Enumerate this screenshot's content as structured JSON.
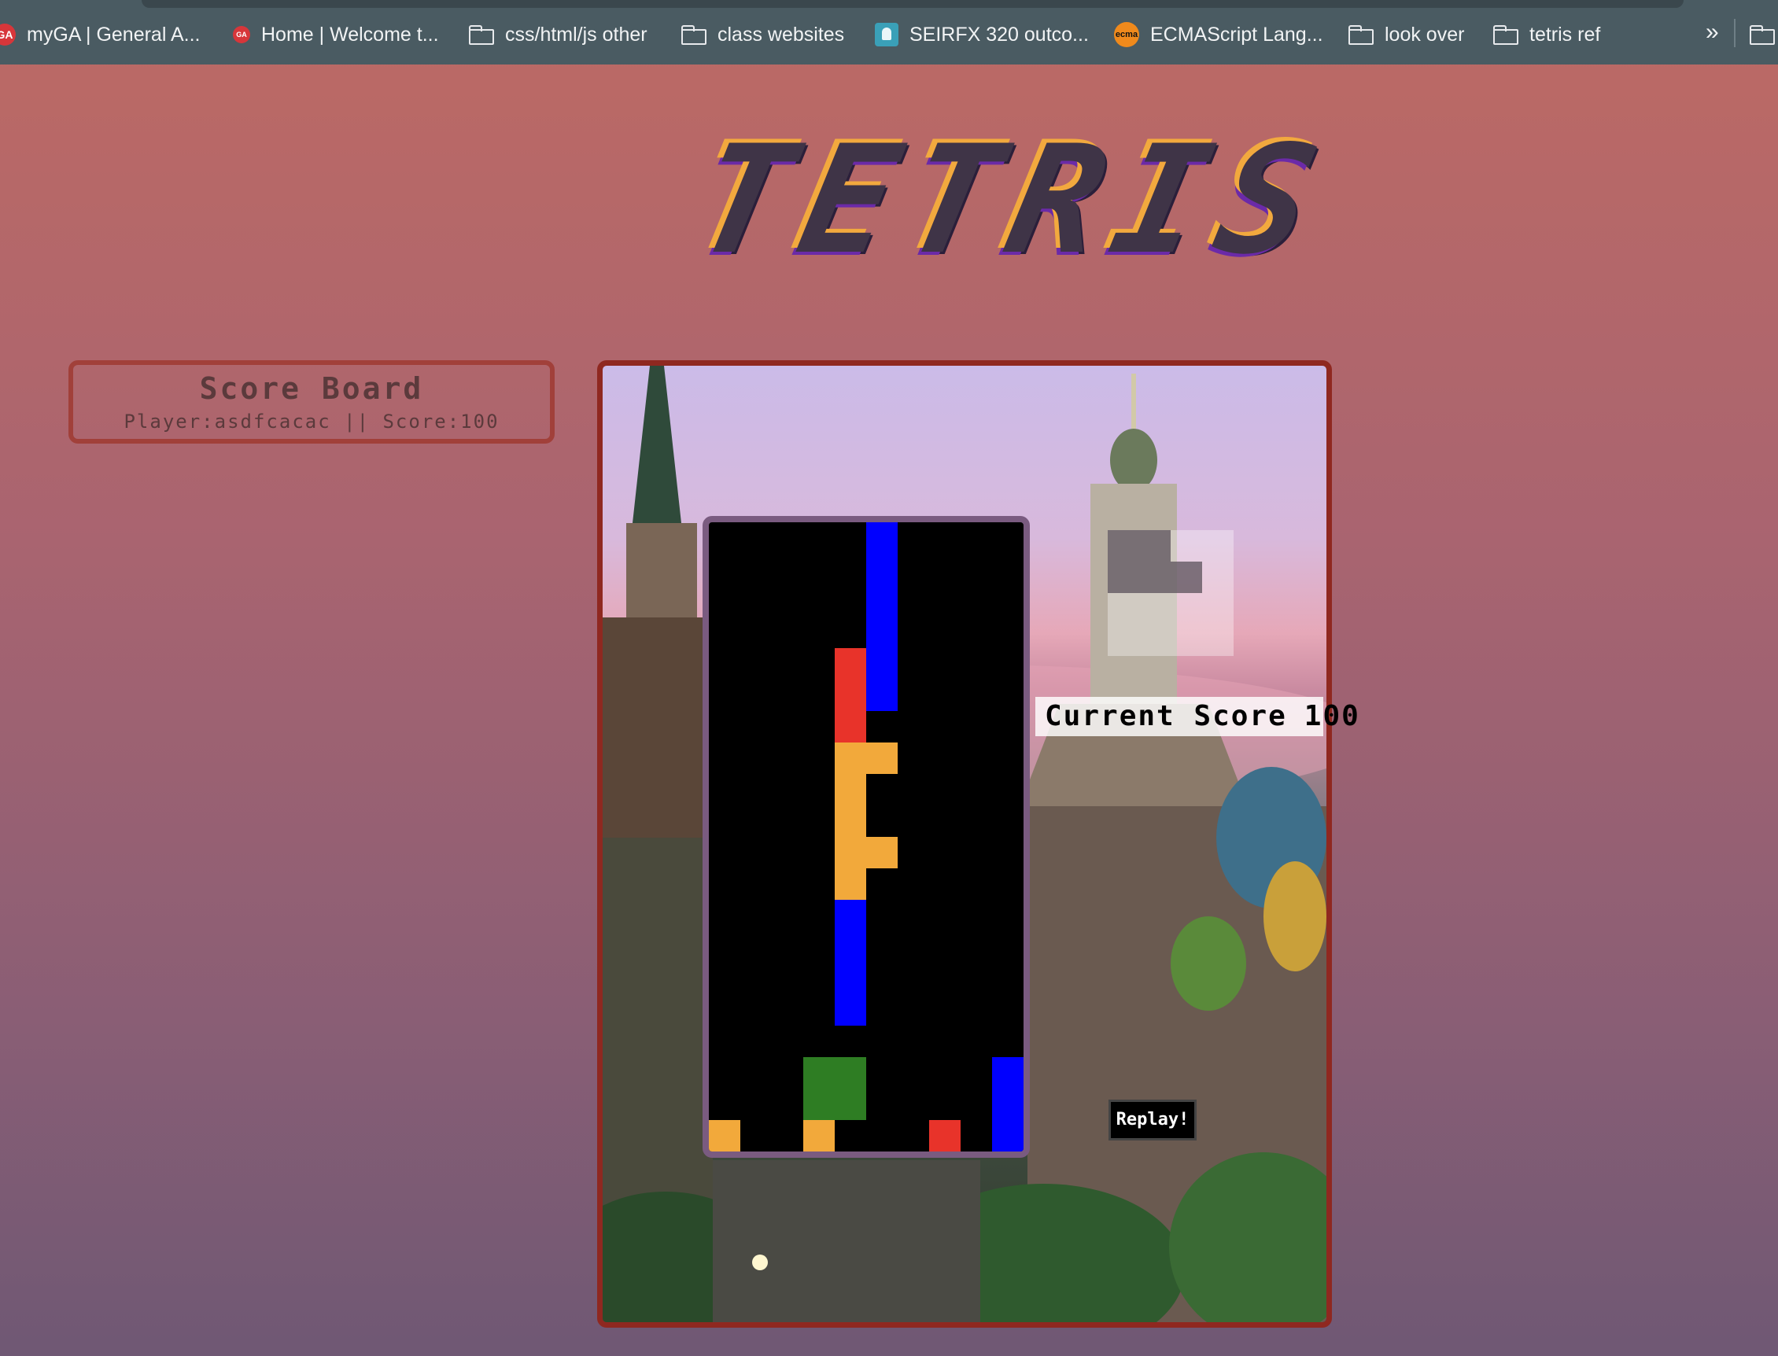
{
  "bookmarks": [
    {
      "label": "myGA | General A...",
      "icon": "ga-logo-icon"
    },
    {
      "label": "Home | Welcome t...",
      "icon": "ga-logo-icon"
    },
    {
      "label": "css/html/js other",
      "icon": "folder-icon"
    },
    {
      "label": "class websites",
      "icon": "folder-icon"
    },
    {
      "label": "SEIRFX 320 outco...",
      "icon": "classroom-icon"
    },
    {
      "label": "ECMAScript Lang...",
      "icon": "ecma-logo-icon"
    },
    {
      "label": "look over",
      "icon": "folder-icon"
    },
    {
      "label": "tetris ref",
      "icon": "folder-icon"
    }
  ],
  "bookmarks_overflow": "»",
  "ga_icon_text": "GA",
  "ecma_icon_text": "ecma",
  "title": "TETRIS",
  "scoreboard": {
    "title": "Score Board",
    "entries": [
      "Player:asdfcacac || Score:100"
    ]
  },
  "game": {
    "current_score_label": "Current Score",
    "current_score_value": "100",
    "replay_label": "Replay!",
    "board_columns": 10,
    "board_rows": 20,
    "cells": [
      {
        "col": 5,
        "row": 0,
        "color": "#0000ff"
      },
      {
        "col": 5,
        "row": 1,
        "color": "#0000ff"
      },
      {
        "col": 5,
        "row": 2,
        "color": "#0000ff"
      },
      {
        "col": 5,
        "row": 3,
        "color": "#0000ff"
      },
      {
        "col": 5,
        "row": 4,
        "color": "#0000ff"
      },
      {
        "col": 5,
        "row": 5,
        "color": "#0000ff"
      },
      {
        "col": 4,
        "row": 4,
        "color": "#e8332a"
      },
      {
        "col": 4,
        "row": 5,
        "color": "#e8332a"
      },
      {
        "col": 4,
        "row": 6,
        "color": "#e8332a"
      },
      {
        "col": 4,
        "row": 7,
        "color": "#f2a93b"
      },
      {
        "col": 5,
        "row": 7,
        "color": "#f2a93b"
      },
      {
        "col": 4,
        "row": 8,
        "color": "#f2a93b"
      },
      {
        "col": 4,
        "row": 9,
        "color": "#f2a93b"
      },
      {
        "col": 4,
        "row": 10,
        "color": "#f2a93b"
      },
      {
        "col": 5,
        "row": 10,
        "color": "#f2a93b"
      },
      {
        "col": 4,
        "row": 11,
        "color": "#f2a93b"
      },
      {
        "col": 4,
        "row": 12,
        "color": "#0000ff"
      },
      {
        "col": 4,
        "row": 13,
        "color": "#0000ff"
      },
      {
        "col": 4,
        "row": 14,
        "color": "#0000ff"
      },
      {
        "col": 4,
        "row": 15,
        "color": "#0000ff"
      },
      {
        "col": 3,
        "row": 17,
        "color": "#2e7d23"
      },
      {
        "col": 4,
        "row": 17,
        "color": "#2e7d23"
      },
      {
        "col": 3,
        "row": 18,
        "color": "#2e7d23"
      },
      {
        "col": 4,
        "row": 18,
        "color": "#2e7d23"
      },
      {
        "col": 9,
        "row": 17,
        "color": "#0000ff"
      },
      {
        "col": 9,
        "row": 18,
        "color": "#0000ff"
      },
      {
        "col": 9,
        "row": 19,
        "color": "#0000ff"
      },
      {
        "col": 0,
        "row": 19,
        "color": "#f2a93b"
      },
      {
        "col": 3,
        "row": 19,
        "color": "#f2a93b"
      },
      {
        "col": 7,
        "row": 19,
        "color": "#e8332a"
      }
    ],
    "next_piece_cells": [
      {
        "col": 0,
        "row": 0
      },
      {
        "col": 1,
        "row": 0
      },
      {
        "col": 0,
        "row": 1
      },
      {
        "col": 1,
        "row": 1
      },
      {
        "col": 2,
        "row": 1
      }
    ]
  }
}
